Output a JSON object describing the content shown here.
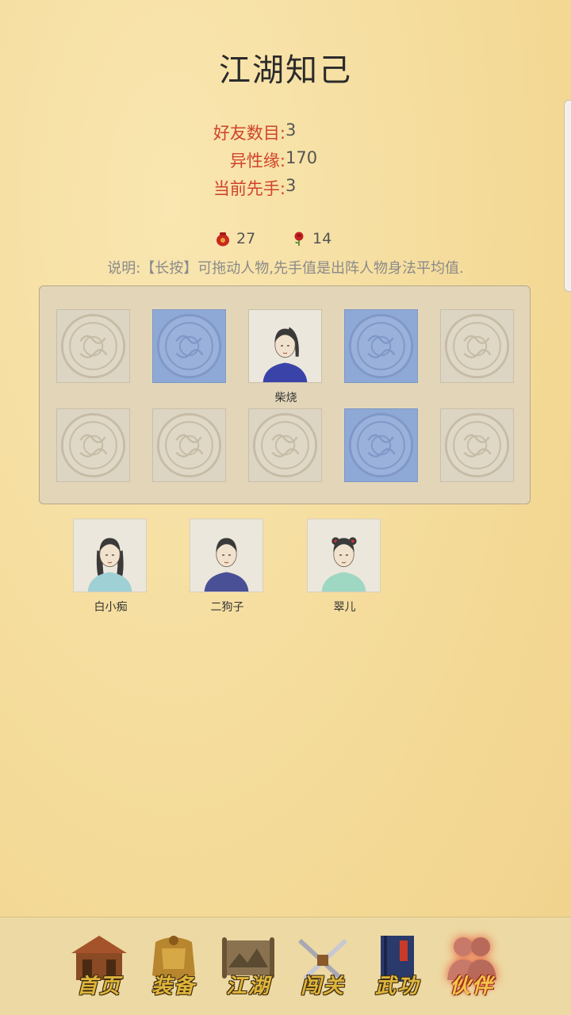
{
  "header": {
    "title": "江湖知己"
  },
  "stats": [
    {
      "key": "好友数目:",
      "value": "3"
    },
    {
      "key": "异性缘:",
      "value": "170"
    },
    {
      "key": "当前先手:",
      "value": "3"
    }
  ],
  "currency": {
    "pouch": {
      "icon": "red-pouch-icon",
      "value": "27"
    },
    "rose": {
      "icon": "rose-icon",
      "value": "14"
    }
  },
  "note": "说明:【长按】可拖动人物,先手值是出阵人物身法平均值.",
  "formation": {
    "slots": [
      {
        "state": "empty"
      },
      {
        "state": "blue"
      },
      {
        "state": "filled",
        "name": "柴烧",
        "portrait": "swordsman-portrait"
      },
      {
        "state": "blue"
      },
      {
        "state": "empty"
      },
      {
        "state": "empty"
      },
      {
        "state": "empty"
      },
      {
        "state": "empty"
      },
      {
        "state": "blue"
      },
      {
        "state": "empty"
      }
    ]
  },
  "reserve": [
    {
      "name": "白小痴",
      "portrait": "woman-long-hair-portrait"
    },
    {
      "name": "二狗子",
      "portrait": "man-blue-robe-portrait"
    },
    {
      "name": "翠儿",
      "portrait": "girl-green-dress-portrait"
    }
  ],
  "nav": [
    {
      "label": "首页",
      "icon": "house-icon",
      "active": false
    },
    {
      "label": "装备",
      "icon": "armor-icon",
      "active": false
    },
    {
      "label": "江湖",
      "icon": "scroll-map-icon",
      "active": false
    },
    {
      "label": "闯关",
      "icon": "crossed-swords-icon",
      "active": false
    },
    {
      "label": "武功",
      "icon": "book-icon",
      "active": false
    },
    {
      "label": "伙伴",
      "icon": "partners-icon",
      "active": true
    }
  ],
  "colors": {
    "accent": "#d0432a",
    "slot_blue": "#8fa9d6",
    "nav_gold": "#e0b53b"
  }
}
